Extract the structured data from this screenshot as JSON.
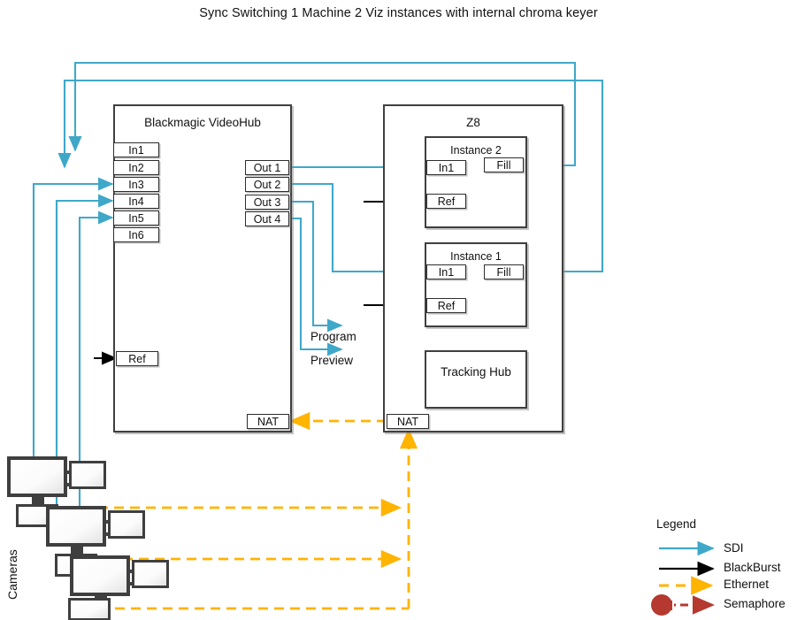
{
  "title": "Sync Switching 1 Machine 2 Viz instances with internal chroma keyer",
  "colors": {
    "sdi": "#3fa8c9",
    "blackburst": "#000000",
    "ethernet": "#ffb400",
    "semaphore": "#b5392f",
    "box_border": "#3f3f3f",
    "background": "#ffffff"
  },
  "videohub": {
    "title": "Blackmagic VideoHub",
    "inputs": [
      {
        "label": "In1"
      },
      {
        "label": "In2"
      },
      {
        "label": "In3"
      },
      {
        "label": "In4"
      },
      {
        "label": "In5"
      },
      {
        "label": "In6"
      }
    ],
    "outputs": [
      {
        "label": "Out 1"
      },
      {
        "label": "Out 2"
      },
      {
        "label": "Out 3"
      },
      {
        "label": "Out 4"
      }
    ],
    "ref": "Ref",
    "nat": "NAT"
  },
  "z8": {
    "title": "Z8",
    "instances": [
      {
        "title": "Instance 2",
        "input": "In1",
        "fill": "Fill",
        "ref": "Ref"
      },
      {
        "title": "Instance 1",
        "input": "In1",
        "fill": "Fill",
        "ref": "Ref"
      }
    ],
    "tracking_hub": "Tracking Hub",
    "nat": "NAT"
  },
  "flows": {
    "program": "Program",
    "preview": "Preview"
  },
  "cameras": {
    "label": "Cameras",
    "count": 3
  },
  "legend": {
    "title": "Legend",
    "items": [
      {
        "label": "SDI",
        "type": "sdi"
      },
      {
        "label": "BlackBurst",
        "type": "blackburst"
      },
      {
        "label": "Ethernet",
        "type": "ethernet"
      },
      {
        "label": "Semaphore",
        "type": "semaphore"
      }
    ]
  }
}
